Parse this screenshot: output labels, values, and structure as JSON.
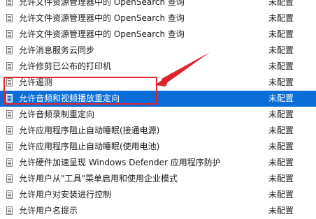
{
  "policies": [
    {
      "name": "允许文件资源管理器中的 OpenSearch 查询",
      "state": "未配置"
    },
    {
      "name": "允许文件资源管理器中的 OpenSearch 查询",
      "state": "未配置"
    },
    {
      "name": "允许文件资源管理器中的 OpenSearch 查询",
      "state": "未配置"
    },
    {
      "name": "允许消息服务云同步",
      "state": "未配置"
    },
    {
      "name": "允许修剪已公布的打印机",
      "state": "未配置"
    },
    {
      "name": "允许遥测",
      "state": "未配置"
    },
    {
      "name": "允许音频和视频播放重定向",
      "state": "未配置"
    },
    {
      "name": "允许音频录制重定向",
      "state": "未配置"
    },
    {
      "name": "允许应用程序阻止自动睡眠(接通电源)",
      "state": "未配置"
    },
    {
      "name": "允许应用程序阻止自动睡眠(使用电池)",
      "state": "未配置"
    },
    {
      "name": "允许硬件加速呈现 Windows Defender 应用程序防护",
      "state": "未配置"
    },
    {
      "name": "允许用户从\"工具\"菜单启用和使用企业模式",
      "state": "未配置"
    },
    {
      "name": "允许用户对安装进行控制",
      "state": "未配置"
    },
    {
      "name": "允许用户名提示",
      "state": "未配置"
    }
  ],
  "selected_index": 6,
  "colors": {
    "selection": "#0a6dd8",
    "annotation": "#e0242d"
  }
}
